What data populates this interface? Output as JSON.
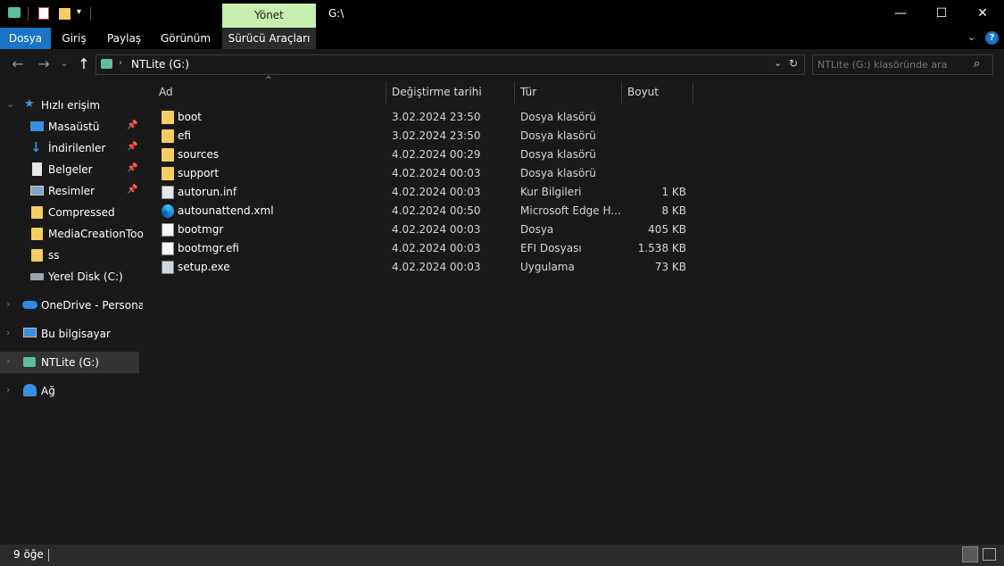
{
  "window": {
    "title": "G:\\",
    "context_tab": "Yönet",
    "controls": {
      "minimize": "—",
      "maximize": "☐",
      "close": "✕"
    }
  },
  "ribbon": {
    "tabs": [
      "Dosya",
      "Giriş",
      "Paylaş",
      "Görünüm",
      "Sürücü Araçları"
    ]
  },
  "address": {
    "path": "NTLite (G:)",
    "search_placeholder": "NTLite (G:) klasöründe ara"
  },
  "nav": {
    "quick_access": "Hızlı erişim",
    "quick_items": [
      {
        "label": "Masaüstü",
        "icon": "desktop-icon",
        "pinned": true
      },
      {
        "label": "İndirilenler",
        "icon": "download-icon",
        "pinned": true
      },
      {
        "label": "Belgeler",
        "icon": "documents-icon",
        "pinned": true
      },
      {
        "label": "Resimler",
        "icon": "pictures-icon",
        "pinned": true
      },
      {
        "label": "Compressed",
        "icon": "folder-icon",
        "pinned": false
      },
      {
        "label": "MediaCreationTool.",
        "icon": "folder-icon",
        "pinned": false
      },
      {
        "label": "ss",
        "icon": "folder-icon",
        "pinned": false
      },
      {
        "label": "Yerel Disk (C:)",
        "icon": "drive-icon",
        "pinned": false
      }
    ],
    "onedrive": "OneDrive - Personal",
    "this_pc": "Bu bilgisayar",
    "current_drive": "NTLite (G:)",
    "network": "Ağ"
  },
  "columns": [
    "Ad",
    "Değiştirme tarihi",
    "Tür",
    "Boyut"
  ],
  "files": [
    {
      "name": "boot",
      "date": "3.02.2024 23:50",
      "type": "Dosya klasörü",
      "size": "",
      "icon": "folder-icon"
    },
    {
      "name": "efi",
      "date": "3.02.2024 23:50",
      "type": "Dosya klasörü",
      "size": "",
      "icon": "folder-icon"
    },
    {
      "name": "sources",
      "date": "4.02.2024 00:29",
      "type": "Dosya klasörü",
      "size": "",
      "icon": "folder-icon"
    },
    {
      "name": "support",
      "date": "4.02.2024 00:03",
      "type": "Dosya klasörü",
      "size": "",
      "icon": "folder-icon"
    },
    {
      "name": "autorun.inf",
      "date": "4.02.2024 00:03",
      "type": "Kur Bilgileri",
      "size": "1 KB",
      "icon": "settings-file-icon"
    },
    {
      "name": "autounattend.xml",
      "date": "4.02.2024 00:50",
      "type": "Microsoft Edge H...",
      "size": "8 KB",
      "icon": "edge-icon"
    },
    {
      "name": "bootmgr",
      "date": "4.02.2024 00:03",
      "type": "Dosya",
      "size": "405 KB",
      "icon": "file-icon"
    },
    {
      "name": "bootmgr.efi",
      "date": "4.02.2024 00:03",
      "type": "EFI Dosyası",
      "size": "1.538 KB",
      "icon": "file-icon"
    },
    {
      "name": "setup.exe",
      "date": "4.02.2024 00:03",
      "type": "Uygulama",
      "size": "73 KB",
      "icon": "setup-icon"
    }
  ],
  "status": {
    "item_count": "9 öğe"
  },
  "colors": {
    "background": "#191919",
    "accent": "#1a74c7",
    "context_tab": "#c6efb0",
    "folder": "#f4cd64"
  }
}
